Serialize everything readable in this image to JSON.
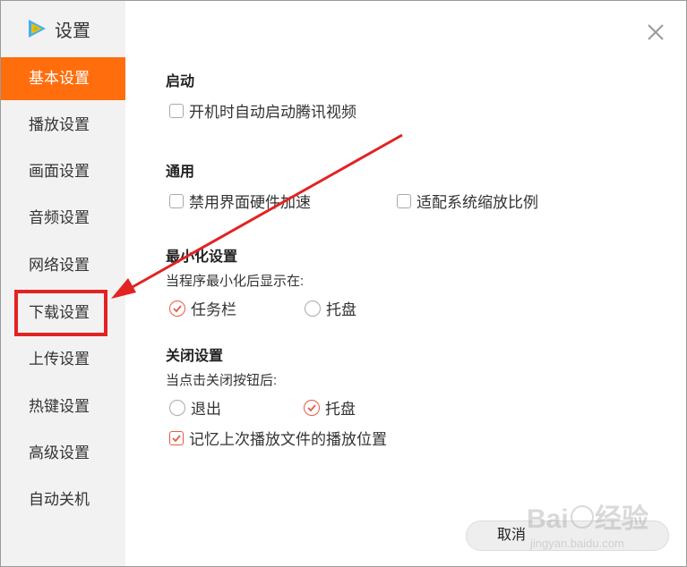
{
  "window": {
    "title": "设置"
  },
  "sidebar": {
    "items": [
      {
        "label": "基本设置",
        "active": true
      },
      {
        "label": "播放设置"
      },
      {
        "label": "画面设置"
      },
      {
        "label": "音频设置"
      },
      {
        "label": "网络设置"
      },
      {
        "label": "下载设置",
        "highlighted": true
      },
      {
        "label": "上传设置"
      },
      {
        "label": "热键设置"
      },
      {
        "label": "高级设置"
      },
      {
        "label": "自动关机"
      }
    ]
  },
  "sections": {
    "startup": {
      "title": "启动",
      "options": [
        {
          "label": "开机时自动启动腾讯视频",
          "checked": false
        }
      ]
    },
    "general": {
      "title": "通用",
      "options": [
        {
          "label": "禁用界面硬件加速",
          "checked": false
        },
        {
          "label": "适配系统缩放比例",
          "checked": false
        }
      ]
    },
    "minimize": {
      "title": "最小化设置",
      "prompt": "当程序最小化后显示在:",
      "options": [
        {
          "label": "任务栏",
          "selected": true
        },
        {
          "label": "托盘",
          "selected": false
        }
      ]
    },
    "close": {
      "title": "关闭设置",
      "prompt": "当点击关闭按钮后:",
      "options": [
        {
          "label": "退出",
          "selected": false
        },
        {
          "label": "托盘",
          "selected": true
        }
      ],
      "remember": {
        "label": "记忆上次播放文件的播放位置",
        "checked": true
      }
    }
  },
  "footer": {
    "cancel_label": "取消"
  },
  "colors": {
    "accent": "#ff6d0d",
    "check": "#e85a46",
    "annotation": "#e32222"
  },
  "watermark": {
    "text": "Baidu经验",
    "sub": "jingyan.baidu.com"
  }
}
